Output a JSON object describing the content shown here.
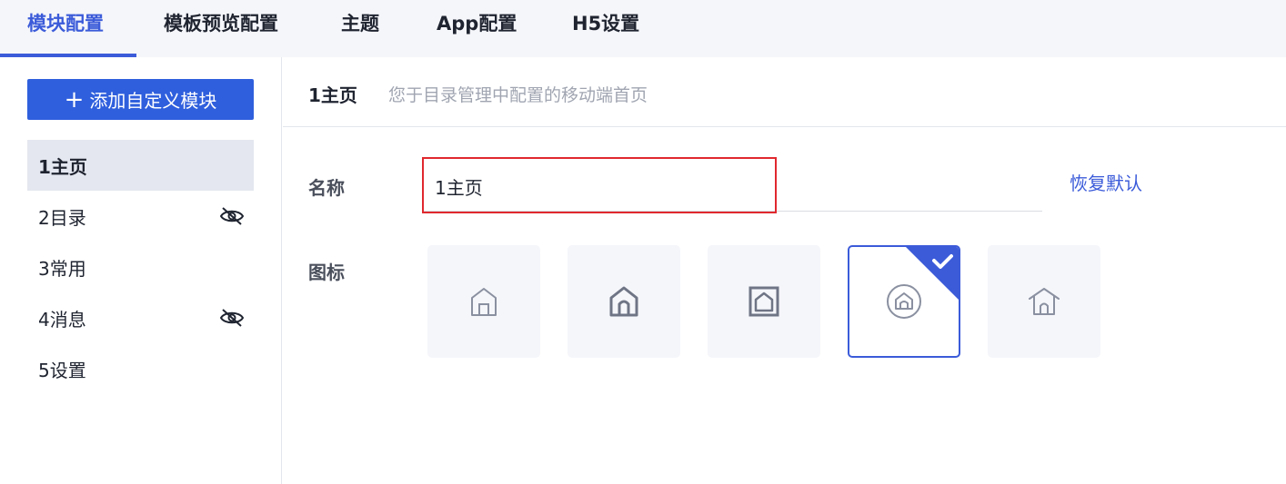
{
  "tabs": [
    {
      "label": "模块配置",
      "active": true
    },
    {
      "label": "模板预览配置",
      "active": false
    },
    {
      "label": "主题",
      "active": false
    },
    {
      "label": "App配置",
      "active": false
    },
    {
      "label": "H5设置",
      "active": false
    }
  ],
  "sidebar": {
    "add_button": {
      "icon": "plus-icon",
      "label": "添加自定义模块"
    },
    "items": [
      {
        "label": "1主页",
        "selected": true,
        "hidden": false
      },
      {
        "label": "2目录",
        "selected": false,
        "hidden": true,
        "icon": "eye-off-icon"
      },
      {
        "label": "3常用",
        "selected": false,
        "hidden": false
      },
      {
        "label": "4消息",
        "selected": false,
        "hidden": true,
        "icon": "eye-off-icon"
      },
      {
        "label": "5设置",
        "selected": false,
        "hidden": false
      }
    ]
  },
  "main": {
    "title": "1主页",
    "description": "您于目录管理中配置的移动端首页",
    "form": {
      "name_label": "名称",
      "name_value": "1主页",
      "restore_label": "恢复默认",
      "icon_label": "图标",
      "icons": [
        {
          "name": "home-outline-1-icon",
          "selected": false
        },
        {
          "name": "home-outline-2-icon",
          "selected": false
        },
        {
          "name": "home-square-icon",
          "selected": false
        },
        {
          "name": "home-circle-icon",
          "selected": true
        },
        {
          "name": "home-outline-3-icon",
          "selected": false
        }
      ]
    }
  },
  "colors": {
    "accent": "#3b5bd9",
    "primary_button": "#2f5fdd",
    "highlight_border": "#e0282e",
    "icon_stroke": "#8a90a0"
  }
}
